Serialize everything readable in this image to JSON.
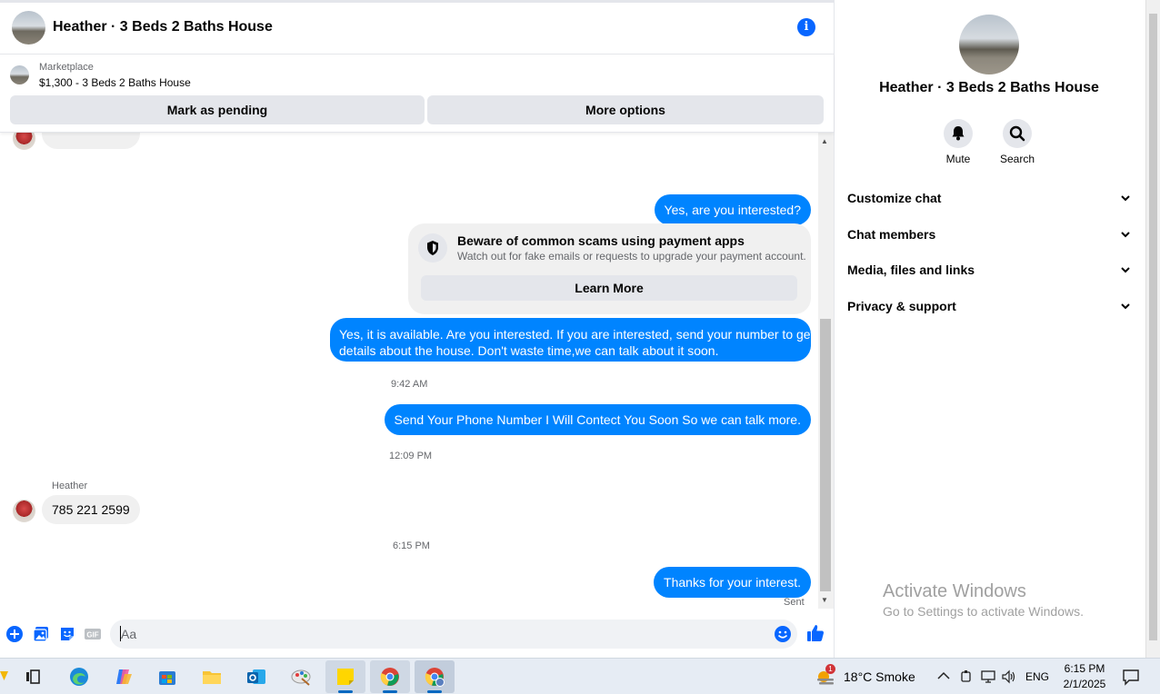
{
  "header": {
    "title": "Heather · 3 Beds 2 Baths House"
  },
  "marketplace": {
    "label": "Marketplace",
    "listing": "$1,300 - 3 Beds 2 Baths House",
    "mark_pending": "Mark as pending",
    "more_options": "More options"
  },
  "messages": {
    "msg1": "Yes, are you interested?",
    "scam_title": "Beware of common scams using payment apps",
    "scam_sub": "Watch out for fake emails or requests to upgrade your payment account.",
    "learn_more": "Learn More",
    "msg2_line1": "Yes, it is available. Are you interested. If you are interested, send your number to get",
    "msg2_line2": "details about the house. Don't waste time,we can talk about it soon.",
    "time1": "9:42 AM",
    "msg3": "Send Your Phone Number I Will Contect You Soon So we can talk more.",
    "time2": "12:09 PM",
    "sender": "Heather",
    "msg4": "785 221 2599",
    "time3": "6:15 PM",
    "msg5": "Thanks for your interest.",
    "status": "Sent"
  },
  "composer": {
    "placeholder": "Aa",
    "gif": "GIF"
  },
  "info": {
    "name": "Heather · 3 Beds 2 Baths House",
    "mute": "Mute",
    "search": "Search",
    "sections": [
      "Customize chat",
      "Chat members",
      "Media, files and links",
      "Privacy & support"
    ]
  },
  "watermark": {
    "line1": "Activate Windows",
    "line2": "Go to Settings to activate Windows."
  },
  "taskbar": {
    "weather_badge": "1",
    "weather": "18°C  Smoke",
    "lang": "ENG",
    "time": "6:15 PM",
    "date": "2/1/2025"
  },
  "colors": {
    "accent": "#0084ff",
    "brand": "#0866ff",
    "bubble_in": "#f0f0f0"
  }
}
